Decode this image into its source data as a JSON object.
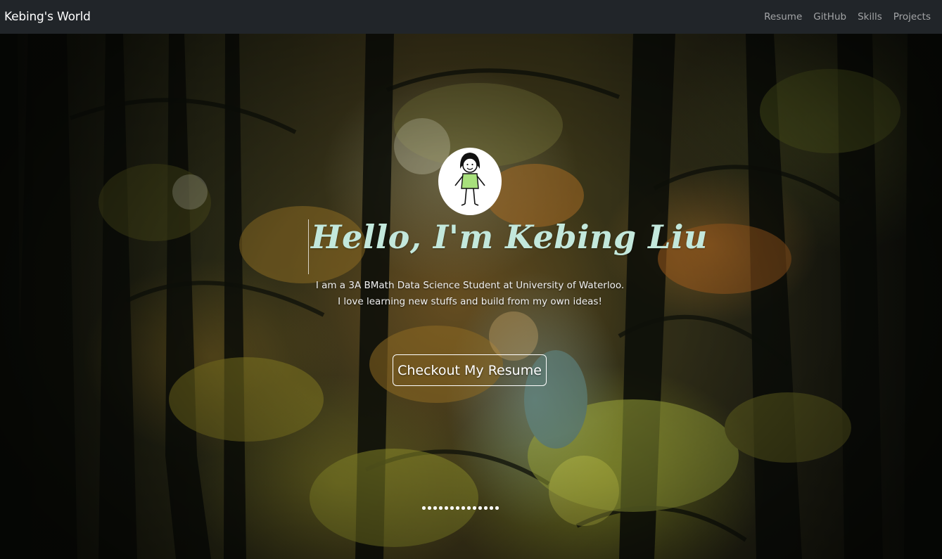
{
  "navbar": {
    "brand": "Kebing's World",
    "links": [
      {
        "label": "Resume"
      },
      {
        "label": "GitHub"
      },
      {
        "label": "Skills"
      },
      {
        "label": "Projects"
      }
    ]
  },
  "hero": {
    "headline": "Hello, I'm Kebing Liu",
    "intro_lines": [
      "I am a 3A BMath Data Science Student at University of Waterloo.",
      "I love learning new stuffs and build from my own ideas!"
    ],
    "cta_label": "Checkout My Resume",
    "carousel_dot_count": 14
  },
  "colors": {
    "navbar_bg": "#212529",
    "headline": "#c3e8dc",
    "avatar_shirt": "#a8e07c"
  }
}
